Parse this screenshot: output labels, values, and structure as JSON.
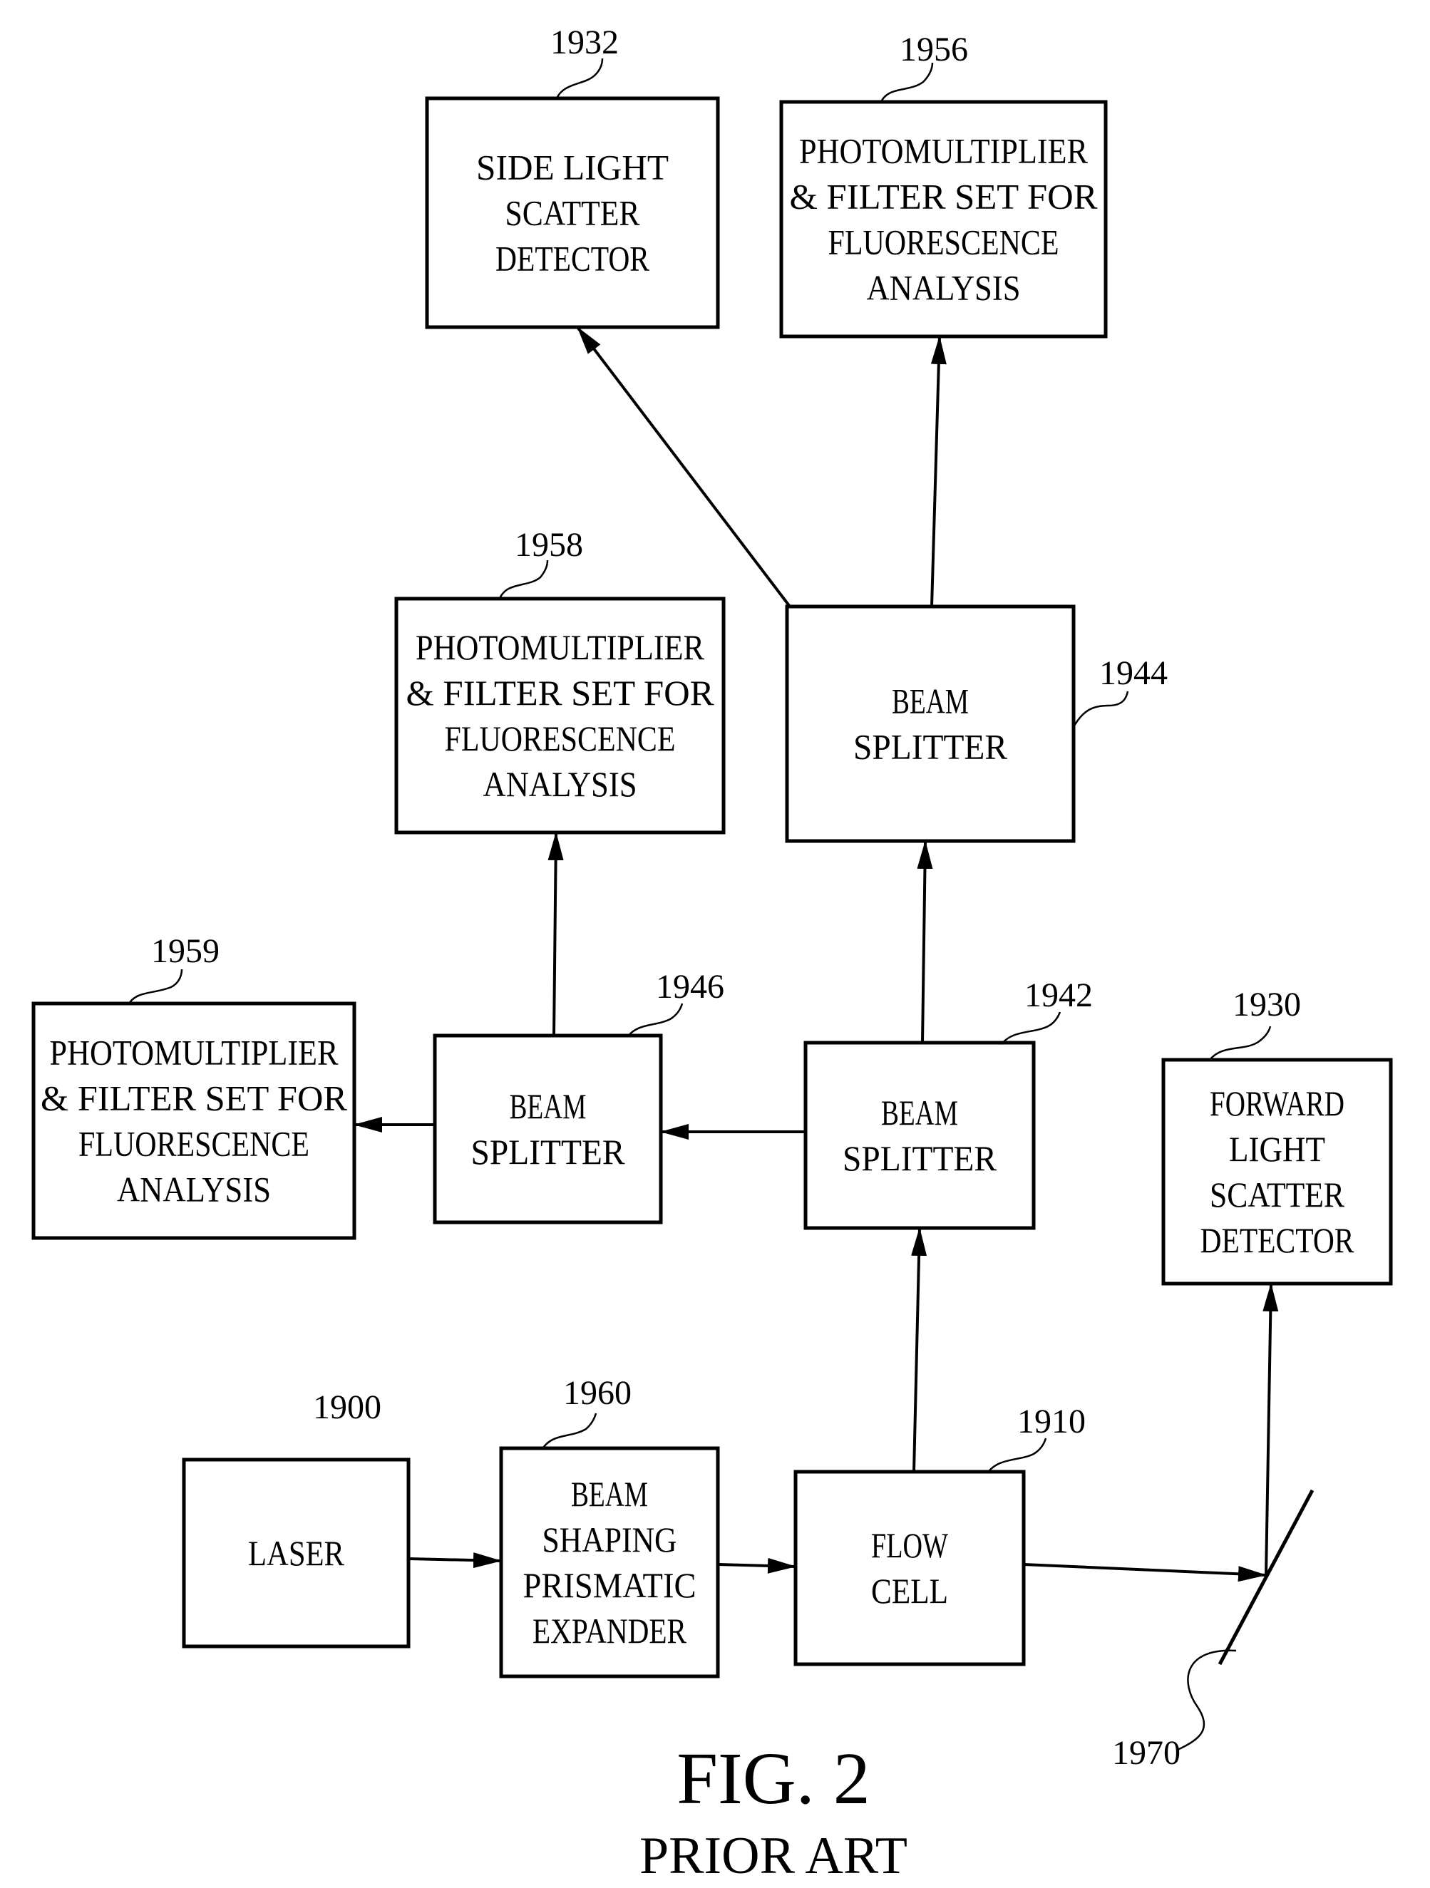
{
  "figure": {
    "title": "FIG. 2",
    "subtitle": "PRIOR ART"
  },
  "colors": {
    "background": "#ffffff",
    "ink": "#000000"
  },
  "blocks": [
    {
      "id": "1900",
      "ref": "1900",
      "lines": [
        "LASER"
      ]
    },
    {
      "id": "1960",
      "ref": "1960",
      "lines": [
        "BEAM",
        "SHAPING",
        "PRISMATIC",
        "EXPANDER"
      ]
    },
    {
      "id": "1910",
      "ref": "1910",
      "lines": [
        "FLOW",
        "CELL"
      ]
    },
    {
      "id": "1942",
      "ref": "1942",
      "lines": [
        "BEAM",
        "SPLITTER"
      ]
    },
    {
      "id": "1946",
      "ref": "1946",
      "lines": [
        "BEAM",
        "SPLITTER"
      ]
    },
    {
      "id": "1944",
      "ref": "1944",
      "lines": [
        "BEAM",
        "SPLITTER"
      ]
    },
    {
      "id": "1959",
      "ref": "1959",
      "lines": [
        "PHOTOMULTIPLIER",
        "& FILTER SET FOR",
        "FLUORESCENCE",
        "ANALYSIS"
      ]
    },
    {
      "id": "1958",
      "ref": "1958",
      "lines": [
        "PHOTOMULTIPLIER",
        "& FILTER SET FOR",
        "FLUORESCENCE",
        "ANALYSIS"
      ]
    },
    {
      "id": "1956",
      "ref": "1956",
      "lines": [
        "PHOTOMULTIPLIER",
        "& FILTER SET FOR",
        "FLUORESCENCE",
        "ANALYSIS"
      ]
    },
    {
      "id": "1932",
      "ref": "1932",
      "lines": [
        "SIDE LIGHT",
        "SCATTER",
        "DETECTOR"
      ]
    },
    {
      "id": "1930",
      "ref": "1930",
      "lines": [
        "FORWARD",
        "LIGHT",
        "SCATTER",
        "DETECTOR"
      ]
    }
  ],
  "mirror": {
    "ref": "1970"
  },
  "connections": [
    {
      "from": "1900",
      "to": "1960"
    },
    {
      "from": "1960",
      "to": "1910"
    },
    {
      "from": "1910",
      "to": "1942"
    },
    {
      "from": "1910",
      "to": "1970"
    },
    {
      "from": "1970",
      "to": "1930"
    },
    {
      "from": "1942",
      "to": "1944"
    },
    {
      "from": "1942",
      "to": "1946"
    },
    {
      "from": "1946",
      "to": "1959"
    },
    {
      "from": "1946",
      "to": "1958"
    },
    {
      "from": "1944",
      "to": "1956"
    },
    {
      "from": "1944",
      "to": "1932"
    }
  ]
}
